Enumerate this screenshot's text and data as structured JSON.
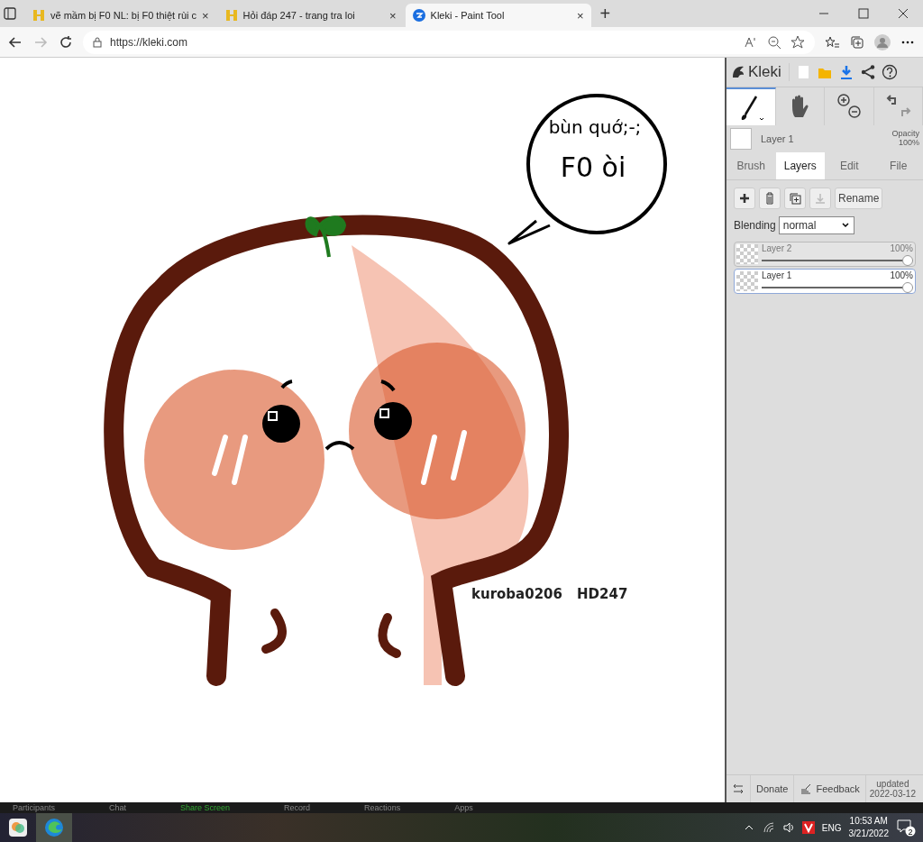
{
  "browser": {
    "tabs": [
      {
        "title": "vẽ mầm bị F0 NL: bị F0 thiệt rùi c",
        "selected": false
      },
      {
        "title": "Hỏi đáp 247 - trang tra loi",
        "selected": false
      },
      {
        "title": "Kleki - Paint Tool",
        "selected": true
      }
    ],
    "close_glyph": "×",
    "new_tab": "+",
    "url": "https://kleki.com"
  },
  "canvas": {
    "bubble_lines": [
      "bùn quớ;-;",
      "F0 òi"
    ],
    "signature": [
      "kuroba0206",
      "HD247"
    ]
  },
  "panel": {
    "logo": "Kleki",
    "current_layer": "Layer 1",
    "opacity_label": "Opacity",
    "opacity_value": "100%",
    "tabs": [
      {
        "label": "Brush",
        "selected": false
      },
      {
        "label": "Layers",
        "selected": true
      },
      {
        "label": "Edit",
        "selected": false
      },
      {
        "label": "File",
        "selected": false
      }
    ],
    "rename_button": "Rename",
    "blending_label": "Blending",
    "blending_value": "normal",
    "layers": [
      {
        "name": "Layer 2",
        "opacity": "100%",
        "level": 1,
        "selected": false
      },
      {
        "name": "Layer 1",
        "opacity": "100%",
        "level": 1,
        "selected": true
      }
    ],
    "footer": {
      "donate": "Donate",
      "feedback": "Feedback",
      "updated": "updated",
      "date": "2022-03-12"
    }
  },
  "meeting_bar": [
    "Participants",
    "Chat",
    "Share Screen",
    "Record",
    "Reactions",
    "Apps"
  ],
  "taskbar": {
    "language": "ENG",
    "time": "10:53 AM",
    "date": "3/21/2022",
    "notifications": "2"
  }
}
